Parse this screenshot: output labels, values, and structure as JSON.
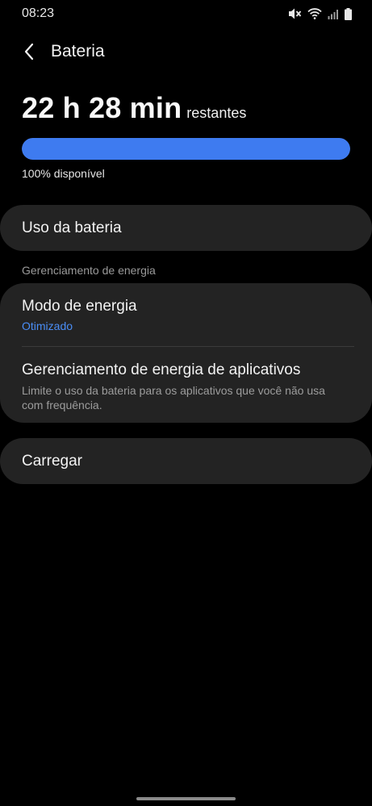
{
  "status_bar": {
    "time": "08:23",
    "icons": [
      "mute-vibrate-icon",
      "wifi-icon",
      "cellular-signal-icon",
      "battery-icon"
    ]
  },
  "header": {
    "back_icon": "chevron-left-icon",
    "title": "Bateria"
  },
  "battery": {
    "remaining_time": "22 h 28 min",
    "remaining_suffix": "restantes",
    "level_percent": 100,
    "available_text": "100% disponível"
  },
  "menu": {
    "battery_usage": "Uso da bateria",
    "section_power_management": "Gerenciamento de energia",
    "power_mode_title": "Modo de energia",
    "power_mode_value": "Otimizado",
    "app_power_title": "Gerenciamento de energia de aplicativos",
    "app_power_desc": "Limite o uso da bateria para os aplicativos que você não usa com frequência.",
    "charging": "Carregar"
  },
  "colors": {
    "accent": "#3e7bf0",
    "link": "#4a8ef6",
    "card": "#232323",
    "background": "#000000"
  }
}
